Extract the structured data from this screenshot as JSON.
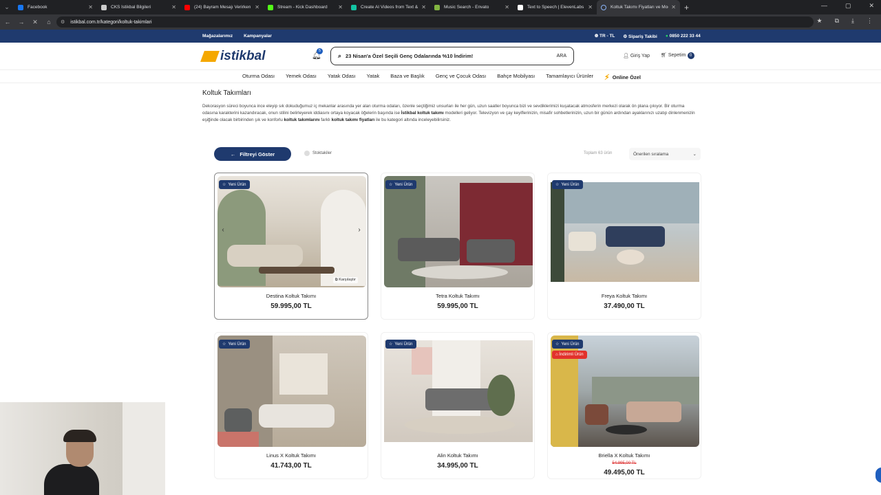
{
  "browser": {
    "tabs": [
      {
        "title": "Facebook",
        "color": "#1877f2"
      },
      {
        "title": "CKS İstikbal Bilgileri",
        "color": "#cccccc"
      },
      {
        "title": "(24) Bayram Mesajı Verirken K...",
        "color": "#ff0000"
      },
      {
        "title": "Stream - Kick Dashboard",
        "color": "#53fc18"
      },
      {
        "title": "Create AI Videos from Text & I...",
        "color": "#13c4a3"
      },
      {
        "title": "Music Search - Envato",
        "color": "#82b541"
      },
      {
        "title": "Text to Speech | ElevenLabs",
        "color": "#ffffff"
      },
      {
        "title": "Koltuk Takımı Fiyatları ve Mod...",
        "color": "#888888"
      }
    ],
    "url": "istikbal.com.tr/kategori/koltuk-takimlari"
  },
  "topbar": {
    "stores": "Mağazalarımız",
    "campaigns": "Kampanyalar",
    "lang": "TR - TL",
    "order_track": "Sipariş Takibi",
    "phone": "0850 222 33 44"
  },
  "header": {
    "logo": "istikbal",
    "notif_count": "5",
    "search_text": "23 Nisan'a Özel Seçili Genç Odalarında %10 İndirim!",
    "search_button": "ARA",
    "login": "Giriş Yap",
    "cart": "Sepetim",
    "cart_count": "0"
  },
  "nav": [
    "Oturma Odası",
    "Yemek Odası",
    "Yatak Odası",
    "Yatak",
    "Baza ve Başlık",
    "Genç ve Çocuk Odası",
    "Bahçe Mobilyası",
    "Tamamlayıcı Ürünler"
  ],
  "nav_special": "Online Özel",
  "page": {
    "title": "Koltuk Takımları",
    "desc_1": "Dekorasyon süreci boyunca ince eleyip sık dokuduğumuz iç mekanlar arasında yer alan oturma odaları, özenle seçtiğimiz unsurları ile her gün, uzun saatler boyunca bizi ve sevdiklerimizi kuşatacak atmosferin merkezi olarak ön plana çıkıyor. Bir oturma odasına karakterini kazandıracak, onun stilini belirleyerek iddiasını ortaya koyacak öğelerin başında ise ",
    "desc_b1": "İstikbal koltuk takımı",
    "desc_2": " modelleri geliyor. Televizyon ve çay keyiflerinizin, misafir sohbetlerinizin, uzun bir günün ardından ayaklarınızı uzatıp dinlenmenizin eşiğinde olacak birbirinden şık ve konforlu ",
    "desc_b2": "koltuk takımlarını",
    "desc_3": " farklı ",
    "desc_b3": "koltuk takımı fiyatları",
    "desc_4": " ile bu kategori altında inceleyebilirsiniz.",
    "filter_button": "Filtreyi Göster",
    "stock": "Stoktakiler",
    "total": "Toplam 63 ürün",
    "sort": "Önerilen sıralama"
  },
  "badges": {
    "new": "Yeni Ürün",
    "discount": "İndirimli Ürün",
    "compare": "Karşılaştır"
  },
  "products": [
    {
      "name": "Destina Koltuk Takımı",
      "price": "59.995,00 TL"
    },
    {
      "name": "Tetra Koltuk Takımı",
      "price": "59.995,00 TL"
    },
    {
      "name": "Freya Koltuk Takımı",
      "price": "37.490,00 TL"
    },
    {
      "name": "Linus X Koltuk Takımı",
      "price": "41.743,00 TL"
    },
    {
      "name": "Alin Koltuk Takımı",
      "price": "34.995,00 TL"
    },
    {
      "name": "Briella X Koltuk Takımı",
      "old_price": "54.995,00 TL",
      "price": "49.495,00 TL"
    }
  ]
}
